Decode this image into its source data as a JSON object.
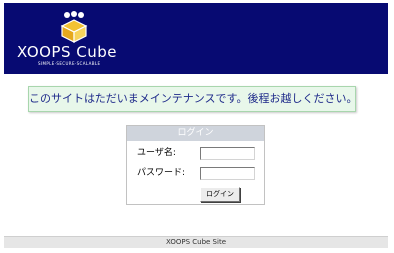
{
  "header": {
    "logo_text": "XOOPS Cube",
    "logo_tagline": "SIMPLE·SECURE·SCALABLE",
    "logo_icon": "cube-logo-icon",
    "background_color": "#070a72"
  },
  "notice": {
    "message": "このサイトはただいまメインテナンスです。後程お越しください。",
    "background_color": "#e8f7ea",
    "text_color": "#1e2a8a"
  },
  "login": {
    "title": "ログイン",
    "username_label": "ユーザ名:",
    "username_value": "",
    "password_label": "パスワード:",
    "password_value": "",
    "submit_label": "ログイン"
  },
  "footer": {
    "text": "XOOPS Cube Site"
  }
}
